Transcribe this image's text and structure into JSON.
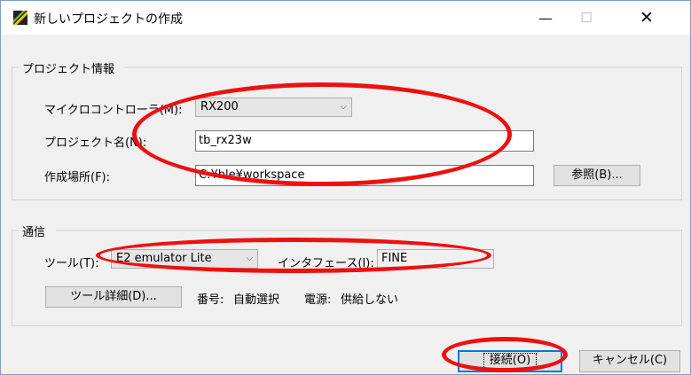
{
  "window": {
    "title": "新しいプロジェクトの作成",
    "icon": "app-icon",
    "controls": [
      "minimize-icon",
      "maximize-icon",
      "close-icon"
    ]
  },
  "project_group": {
    "title": "プロジェクト情報",
    "microcontroller_label": "マイクロコントローラ(M):",
    "microcontroller_value": "RX200",
    "project_name_label": "プロジェクト名(N):",
    "project_name_value": "tb_rx23w",
    "location_label": "作成場所(F):",
    "location_value": "C:¥ble¥workspace",
    "browse_button": "参照(B)..."
  },
  "comm_group": {
    "title": "通信",
    "tool_label": "ツール(T):",
    "tool_value": "E2 emulator Lite",
    "interface_label": "インタフェース(I):",
    "interface_value": "FINE",
    "tool_detail_button": "ツール詳細(D)...",
    "number_label": "番号:",
    "number_value": "自動選択",
    "power_label": "電源:",
    "power_value": "供給しない"
  },
  "footer": {
    "connect_button": "接続(O)",
    "cancel_button": "キャンセル(C)"
  },
  "colors": {
    "annotation": "#ee1010",
    "focus_border": "#0078d7",
    "dialog_bg": "#f0f0f0"
  }
}
